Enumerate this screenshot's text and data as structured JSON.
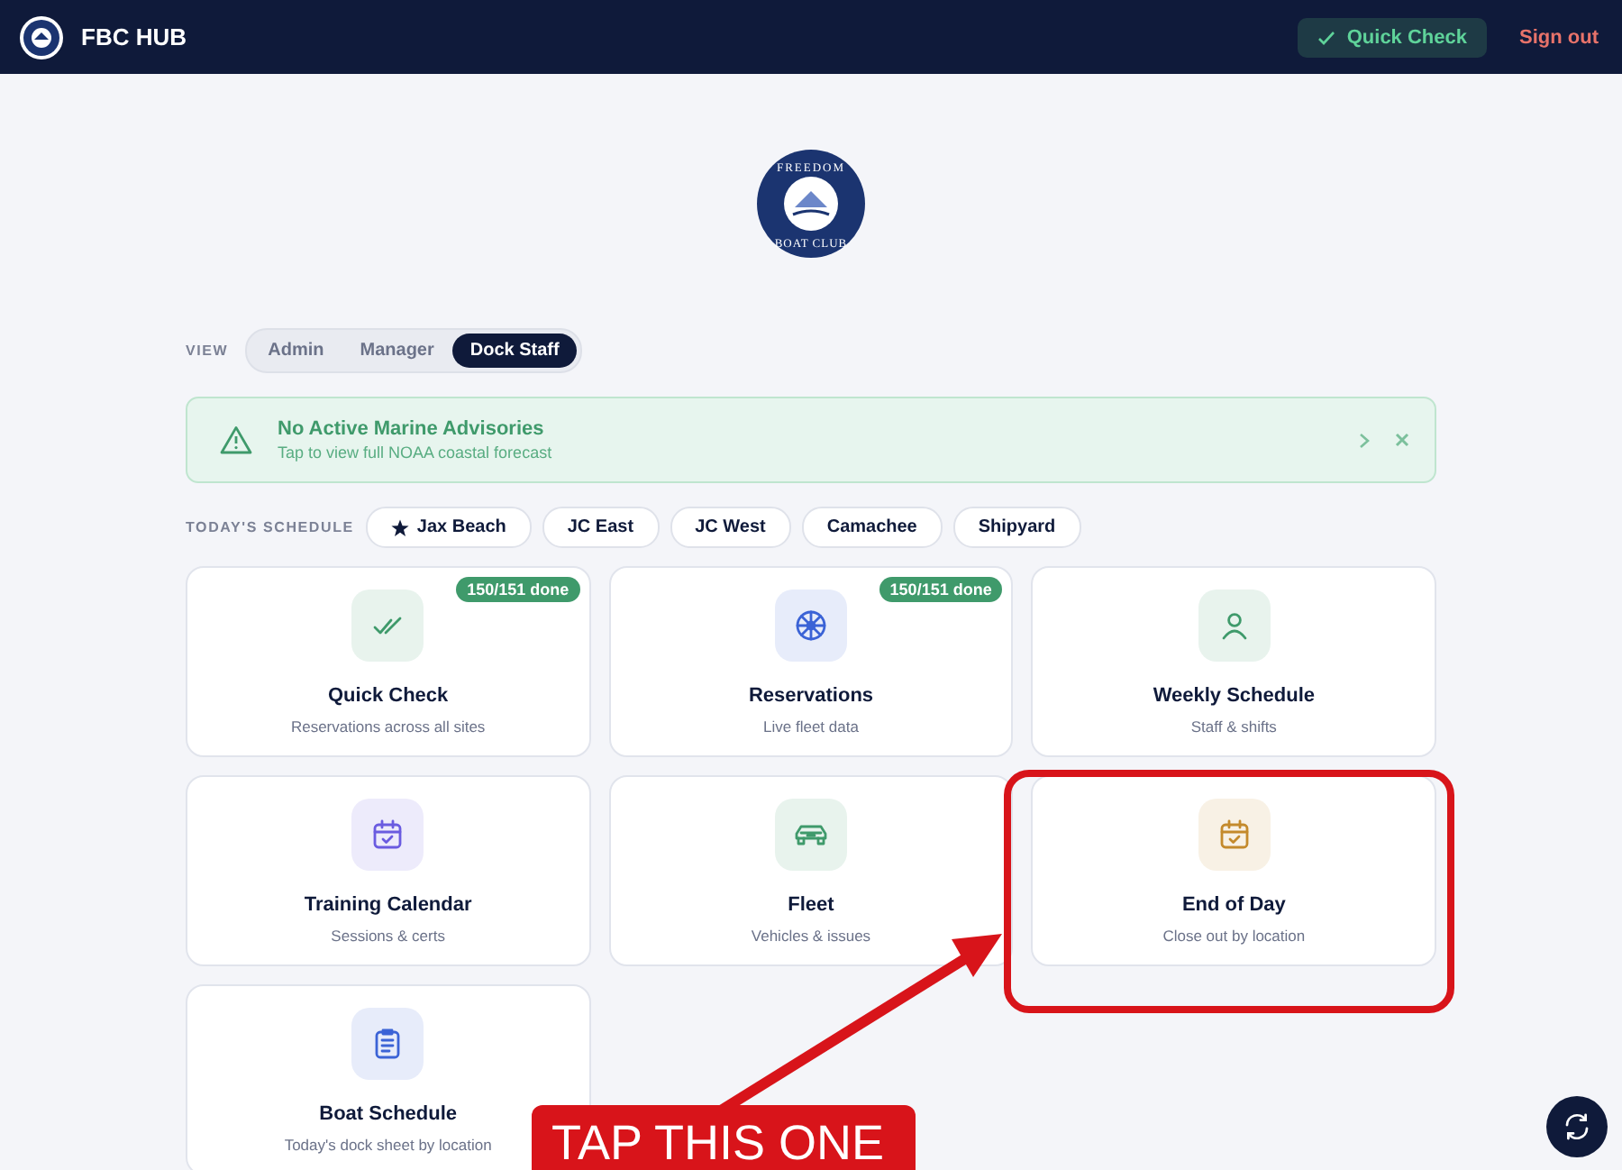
{
  "header": {
    "brand": "FBC HUB",
    "quick_check": "Quick Check",
    "sign_out": "Sign out"
  },
  "logo": {
    "top_text": "FREEDOM",
    "bottom_text": "BOAT CLUB"
  },
  "view": {
    "label": "VIEW",
    "options": [
      {
        "label": "Admin",
        "selected": false
      },
      {
        "label": "Manager",
        "selected": false
      },
      {
        "label": "Dock Staff",
        "selected": true
      }
    ]
  },
  "advisory": {
    "title": "No Active Marine Advisories",
    "subtitle": "Tap to view full NOAA coastal forecast"
  },
  "schedule": {
    "label": "TODAY'S SCHEDULE",
    "locations": [
      {
        "label": "Jax Beach",
        "starred": true
      },
      {
        "label": "JC East",
        "starred": false
      },
      {
        "label": "JC West",
        "starred": false
      },
      {
        "label": "Camachee",
        "starred": false
      },
      {
        "label": "Shipyard",
        "starred": false
      }
    ]
  },
  "cards": [
    {
      "title": "Quick Check",
      "subtitle": "Reservations across all sites",
      "badge": "150/151 done",
      "kind": "check",
      "color": "#3f9a6b"
    },
    {
      "title": "Reservations",
      "subtitle": "Live fleet data",
      "badge": "150/151 done",
      "kind": "wheel",
      "color": "#3b63d6"
    },
    {
      "title": "Weekly Schedule",
      "subtitle": "Staff & shifts",
      "kind": "person",
      "color": "#3f9a6b"
    },
    {
      "title": "Training Calendar",
      "subtitle": "Sessions & certs",
      "kind": "calendar",
      "color": "#6a5be0"
    },
    {
      "title": "Fleet",
      "subtitle": "Vehicles & issues",
      "kind": "car",
      "color": "#3f9a6b"
    },
    {
      "title": "End of Day",
      "subtitle": "Close out by location",
      "kind": "calendar",
      "color": "#c48a2c"
    },
    {
      "title": "Boat Schedule",
      "subtitle": "Today's dock sheet by location",
      "kind": "clipboard",
      "color": "#3b63d6"
    }
  ],
  "annotation": {
    "label": "TAP THIS ONE"
  }
}
